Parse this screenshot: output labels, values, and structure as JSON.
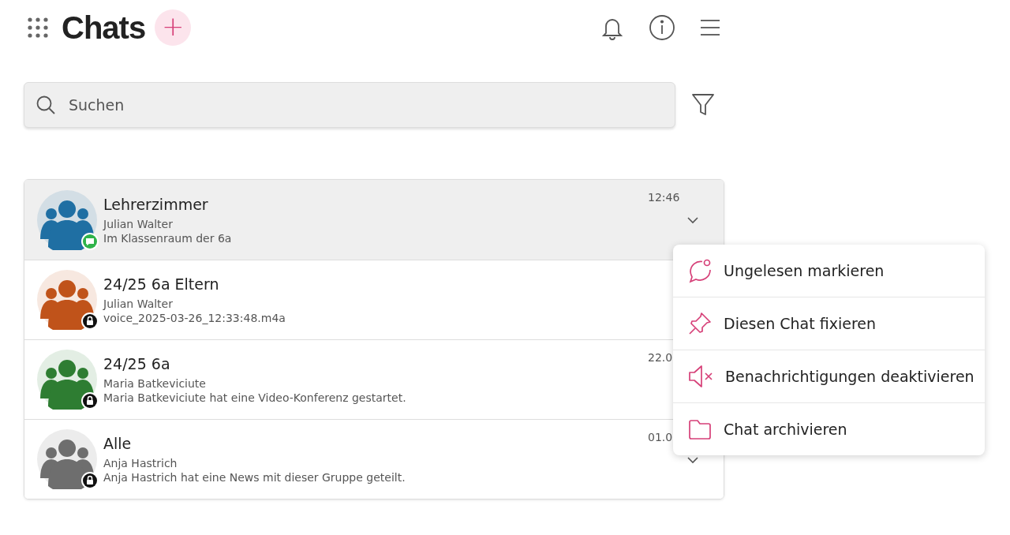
{
  "header": {
    "title": "Chats",
    "add_button": "+"
  },
  "search": {
    "placeholder": "Suchen"
  },
  "chats": [
    {
      "name": "Lehrerzimmer",
      "sender": "Julian Walter",
      "preview": "Im Klassenraum der 6a",
      "time": "12:46",
      "selected": true,
      "color": "#1f6fa3",
      "kind": "chat"
    },
    {
      "name": "24/25 6a Eltern",
      "sender": "Julian Walter",
      "preview": "voice_2025-03-26_12:33:48.m4a",
      "selected": false,
      "color": "#c0531a",
      "kind": "lock"
    },
    {
      "name": "24/25 6a",
      "sender": "Maria Batkeviciute",
      "preview": "Maria Batkeviciute hat eine Video-Konferenz gestartet.",
      "time": "22.0",
      "selected": false,
      "color": "#2e7d32",
      "kind": "lock"
    },
    {
      "name": "Alle",
      "sender": "Anja Hastrich",
      "preview": "Anja Hastrich hat eine News mit dieser Gruppe geteilt.",
      "time": "01.0",
      "selected": false,
      "color": "#6e6e6e",
      "kind": "lock"
    }
  ],
  "menu": [
    {
      "label": "Ungelesen markieren",
      "kind": "unread"
    },
    {
      "label": "Diesen Chat fixieren",
      "kind": "pin"
    },
    {
      "label": "Benachrichtigungen deaktivieren",
      "kind": "mute"
    },
    {
      "label": "Chat archivieren",
      "kind": "archive"
    }
  ]
}
